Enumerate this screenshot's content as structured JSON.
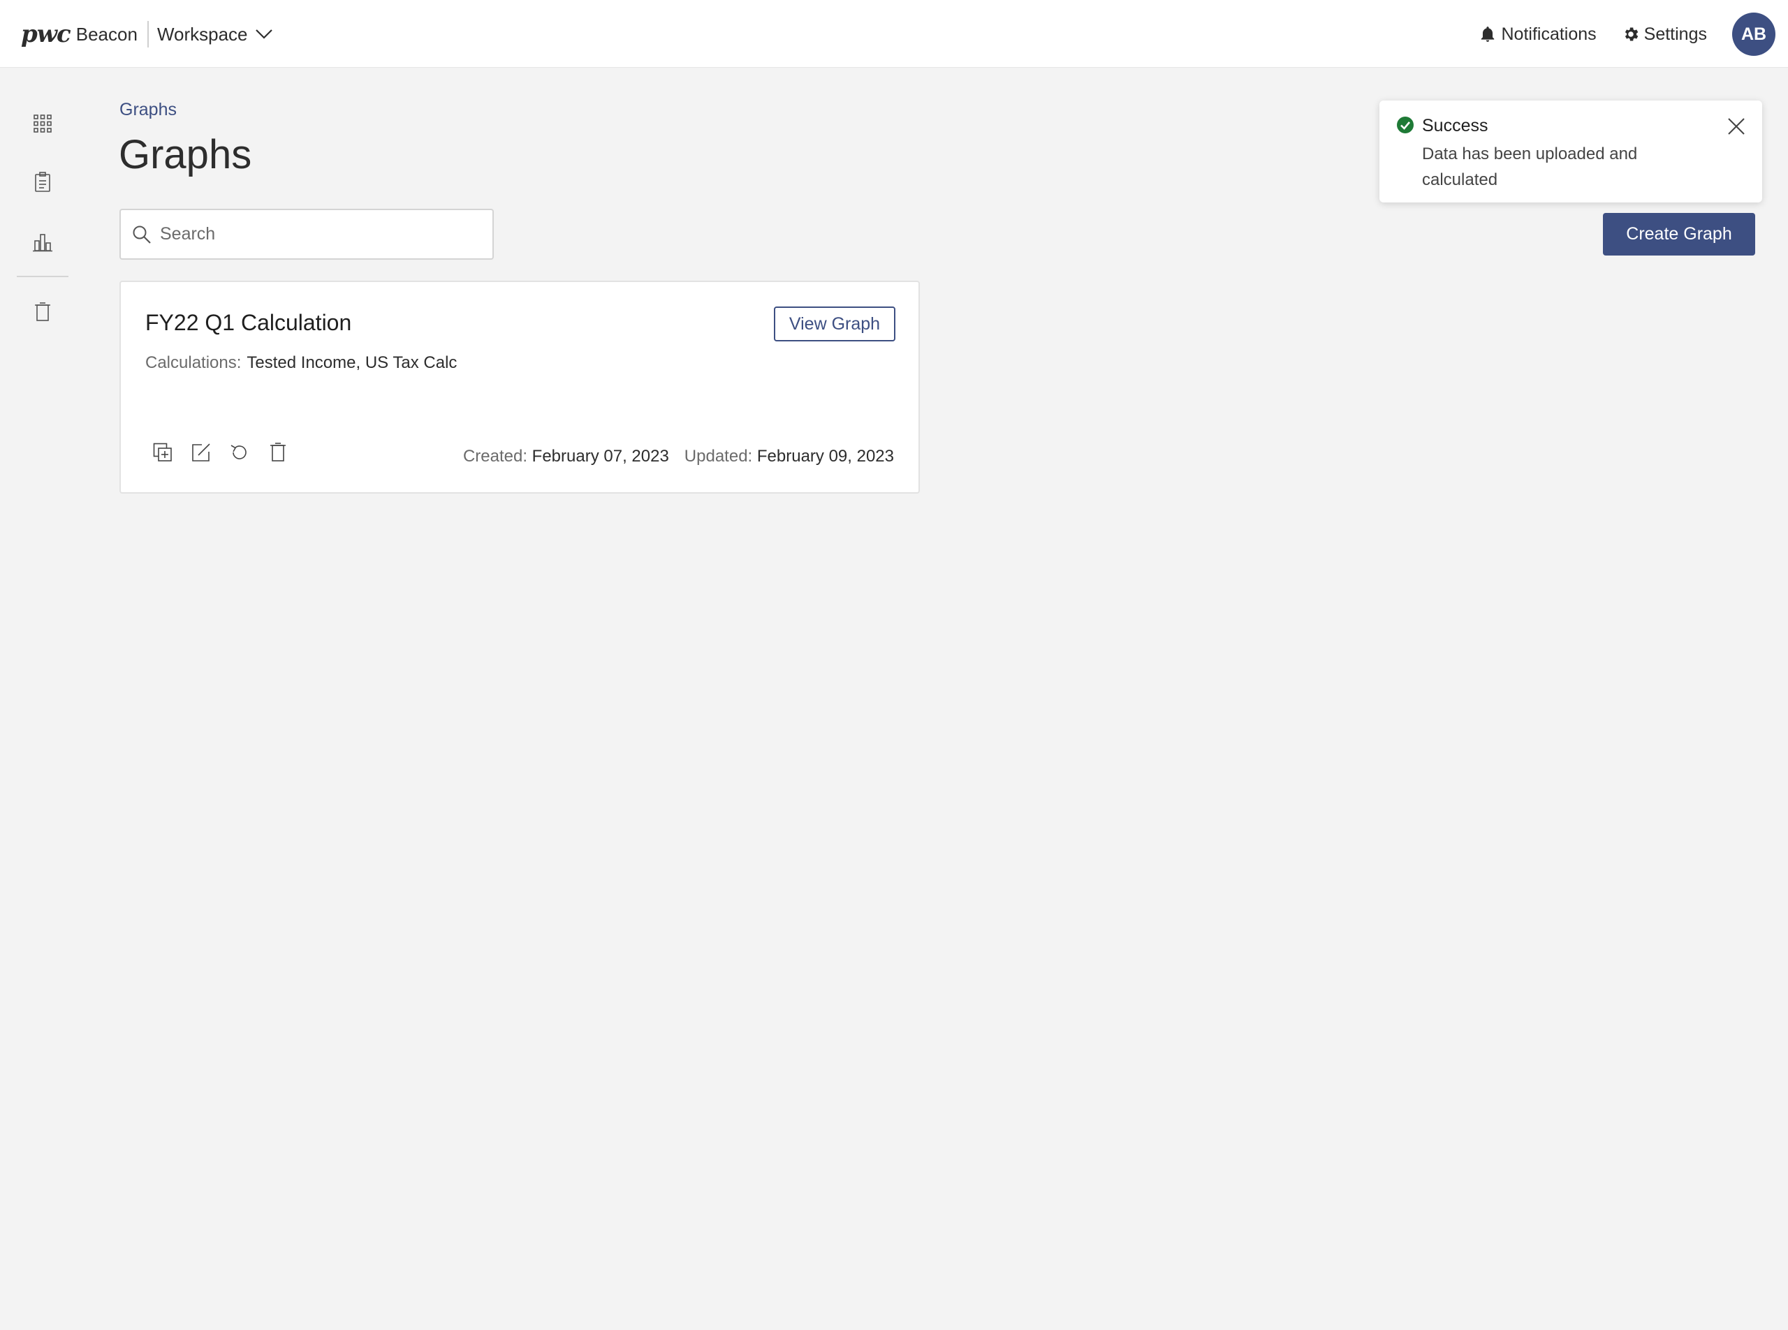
{
  "header": {
    "logo": "pwc",
    "product": "Beacon",
    "workspace_label": "Workspace",
    "notifications_label": "Notifications",
    "settings_label": "Settings",
    "avatar_initials": "AB"
  },
  "sidebar": {
    "items": [
      {
        "icon": "grid-icon"
      },
      {
        "icon": "clipboard-icon"
      },
      {
        "icon": "bar-chart-icon"
      },
      {
        "icon": "trash-icon"
      }
    ]
  },
  "main": {
    "breadcrumb": "Graphs",
    "title": "Graphs",
    "search_placeholder": "Search",
    "create_button": "Create Graph"
  },
  "card": {
    "title": "FY22 Q1 Calculation",
    "view_button": "View Graph",
    "calculations_label": "Calculations:",
    "calculations_value": "Tested Income, US Tax Calc",
    "created_label": "Created:",
    "created_value": "February 07, 2023",
    "updated_label": "Updated:",
    "updated_value": "February 09, 2023",
    "actions": [
      "copy-icon",
      "edit-icon",
      "refresh-icon",
      "delete-icon"
    ]
  },
  "toast": {
    "title": "Success",
    "message": "Data has been uploaded and calculated"
  },
  "colors": {
    "brand": "#3d4f82",
    "success": "#1e7a36",
    "background": "#f3f3f3"
  }
}
